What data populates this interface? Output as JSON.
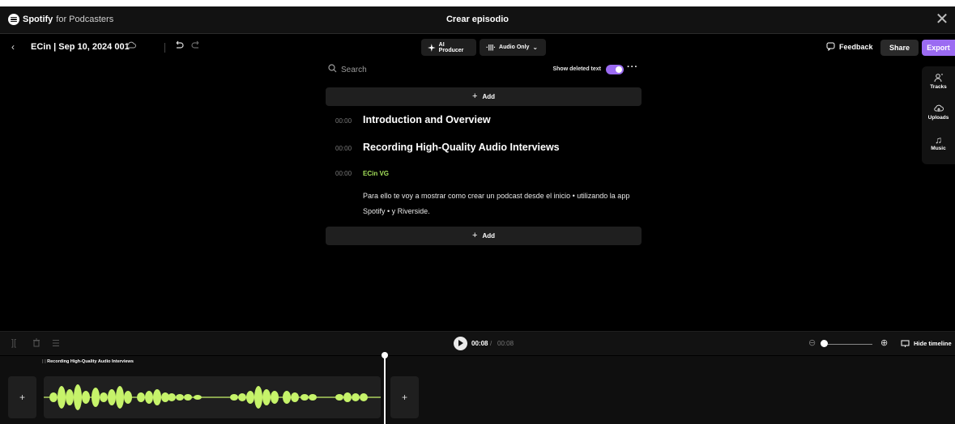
{
  "window": {
    "brand_name": "Spotify",
    "brand_suffix": "for Podcasters",
    "title": "Crear episodio",
    "close_glyph": "✕"
  },
  "toolbar": {
    "back_glyph": "‹",
    "episode_name": "ECin | Sep 10, 2024 001",
    "ai_producer": "AI Producer",
    "audio_mode": "Audio Only",
    "feedback": "Feedback",
    "share": "Share",
    "export": "Export"
  },
  "editor": {
    "search_placeholder": "Search",
    "show_deleted_label": "Show deleted text",
    "show_deleted_on": true,
    "add_label": "Add",
    "segments": [
      {
        "time": "00:00",
        "title": "Introduction and Overview"
      },
      {
        "time": "00:00",
        "title": "Recording High-Quality Audio Interviews"
      }
    ],
    "speaker_block": {
      "time": "00:00",
      "speaker": "ECin VG",
      "text": "Para ello te voy a mostrar como crear un podcast desde el inicio • utilizando la app Spotify • y Riverside."
    }
  },
  "side_panel": {
    "items": [
      {
        "label": "Tracks",
        "icon": "user-tracks-icon"
      },
      {
        "label": "Uploads",
        "icon": "cloud-upload-icon"
      },
      {
        "label": "Music",
        "icon": "music-note-icon"
      }
    ]
  },
  "transport": {
    "current_time": "00:08",
    "separator": "/",
    "total_time": "00:08",
    "hide_timeline": "Hide timeline",
    "zoom_level": 0.0
  },
  "timeline": {
    "track_title": "Recording High-Quality Audio Interviews",
    "add_glyph": "+",
    "waveform_color": "#c6f36a"
  },
  "colors": {
    "accent": "#9b6bf2",
    "speaker": "#a4e05a",
    "waveform": "#c6f36a"
  }
}
